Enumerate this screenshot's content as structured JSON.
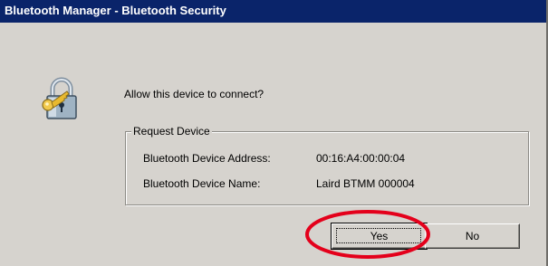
{
  "window": {
    "title": "Bluetooth Manager - Bluetooth Security"
  },
  "icon": "padlock-key-icon",
  "dialog": {
    "prompt": "Allow this device to connect?",
    "group": {
      "legend": "Request Device",
      "rows": [
        {
          "label": "Bluetooth Device Address:",
          "value": "00:16:A4:00:00:04"
        },
        {
          "label": "Bluetooth Device Name:",
          "value": "Laird BTMM 000004"
        }
      ]
    }
  },
  "buttons": {
    "yes": "Yes",
    "no": "No"
  },
  "colors": {
    "titlebar": "#0a246a",
    "dialog_bg": "#d6d3ce",
    "highlight": "#e4001b"
  }
}
